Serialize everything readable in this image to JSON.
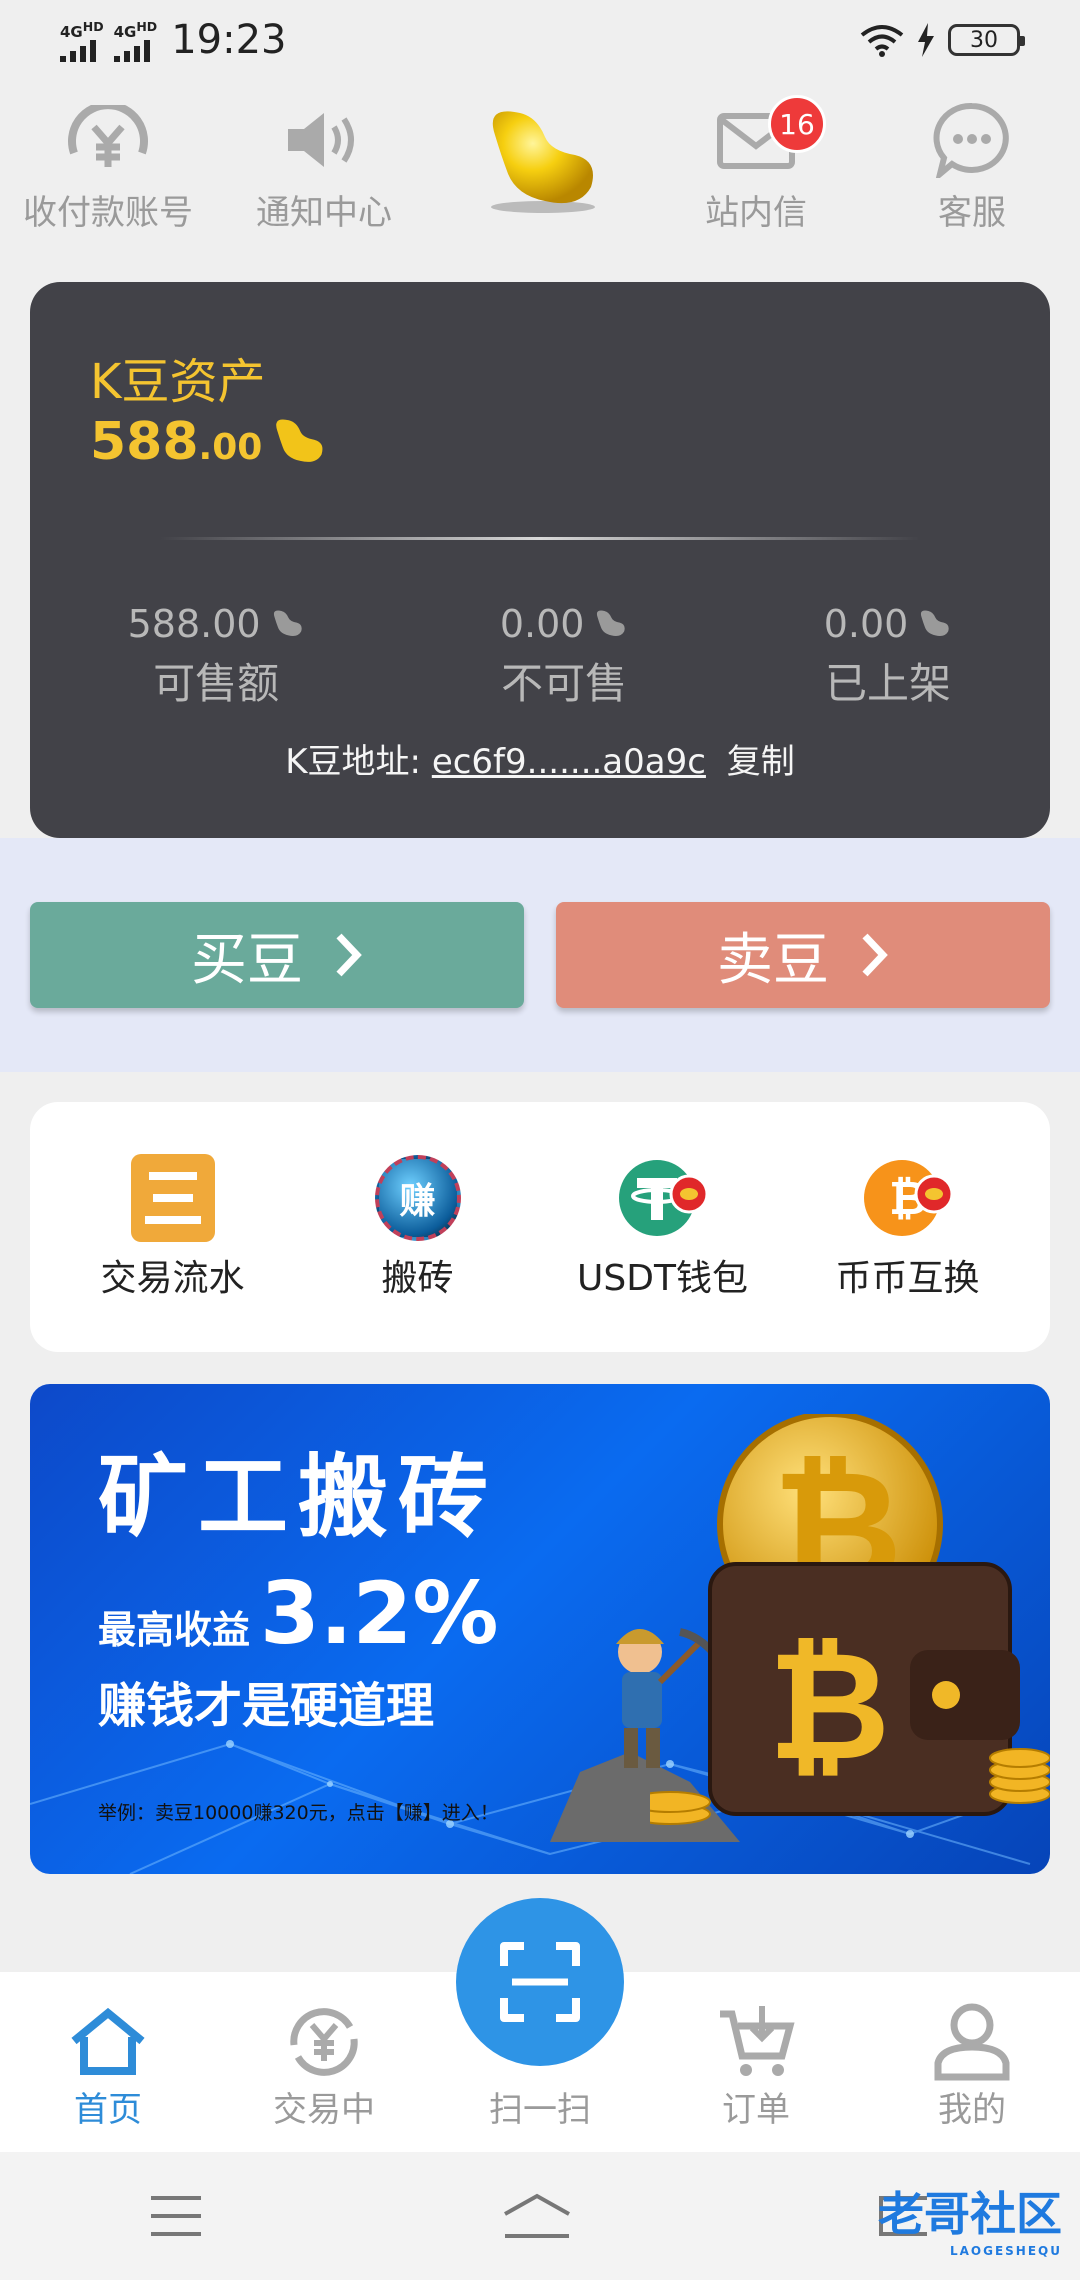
{
  "status_bar": {
    "network_1": "4G",
    "network_1_hd": "HD",
    "network_2": "4G",
    "network_2_hd": "HD",
    "time": "19:23",
    "battery": "30"
  },
  "top_nav": {
    "payment_account": "收付款账号",
    "notifications": "通知中心",
    "inbox": "站内信",
    "inbox_badge": "16",
    "service": "客服"
  },
  "asset_card": {
    "title": "K豆资产",
    "amount_int": "588",
    "amount_dec": ".00",
    "stats": [
      {
        "value": "588.00",
        "label": "可售额"
      },
      {
        "value": "0.00",
        "label": "不可售"
      },
      {
        "value": "0.00",
        "label": "已上架"
      }
    ],
    "address_label": "K豆地址:",
    "address_value": "ec6f9.......a0a9c",
    "copy": "复制"
  },
  "actions": {
    "buy": "买豆",
    "sell": "卖豆"
  },
  "quick_menu": [
    {
      "label": "交易流水",
      "icon": "list-icon"
    },
    {
      "label": "搬砖",
      "icon": "earn-icon",
      "icon_text": "赚"
    },
    {
      "label": "USDT钱包",
      "icon": "tether-icon"
    },
    {
      "label": "币币互换",
      "icon": "bitcoin-icon"
    }
  ],
  "banner": {
    "headline": "矿工搬砖",
    "yield_prefix": "最高收益",
    "yield_value": "3.2%",
    "tagline": "赚钱才是硬道理",
    "example": "举例：卖豆10000赚320元，点击【赚】进入！"
  },
  "tab_bar": {
    "home": "首页",
    "trading": "交易中",
    "scan": "扫一扫",
    "orders": "订单",
    "mine": "我的"
  },
  "watermark": {
    "text": "老哥社区",
    "sub": "LAOGESHEQU"
  },
  "colors": {
    "gold": "#f4c430",
    "card_bg": "#424248",
    "buy": "#6aaa9b",
    "sell": "#e08c7a",
    "accent": "#2e8cd8"
  }
}
